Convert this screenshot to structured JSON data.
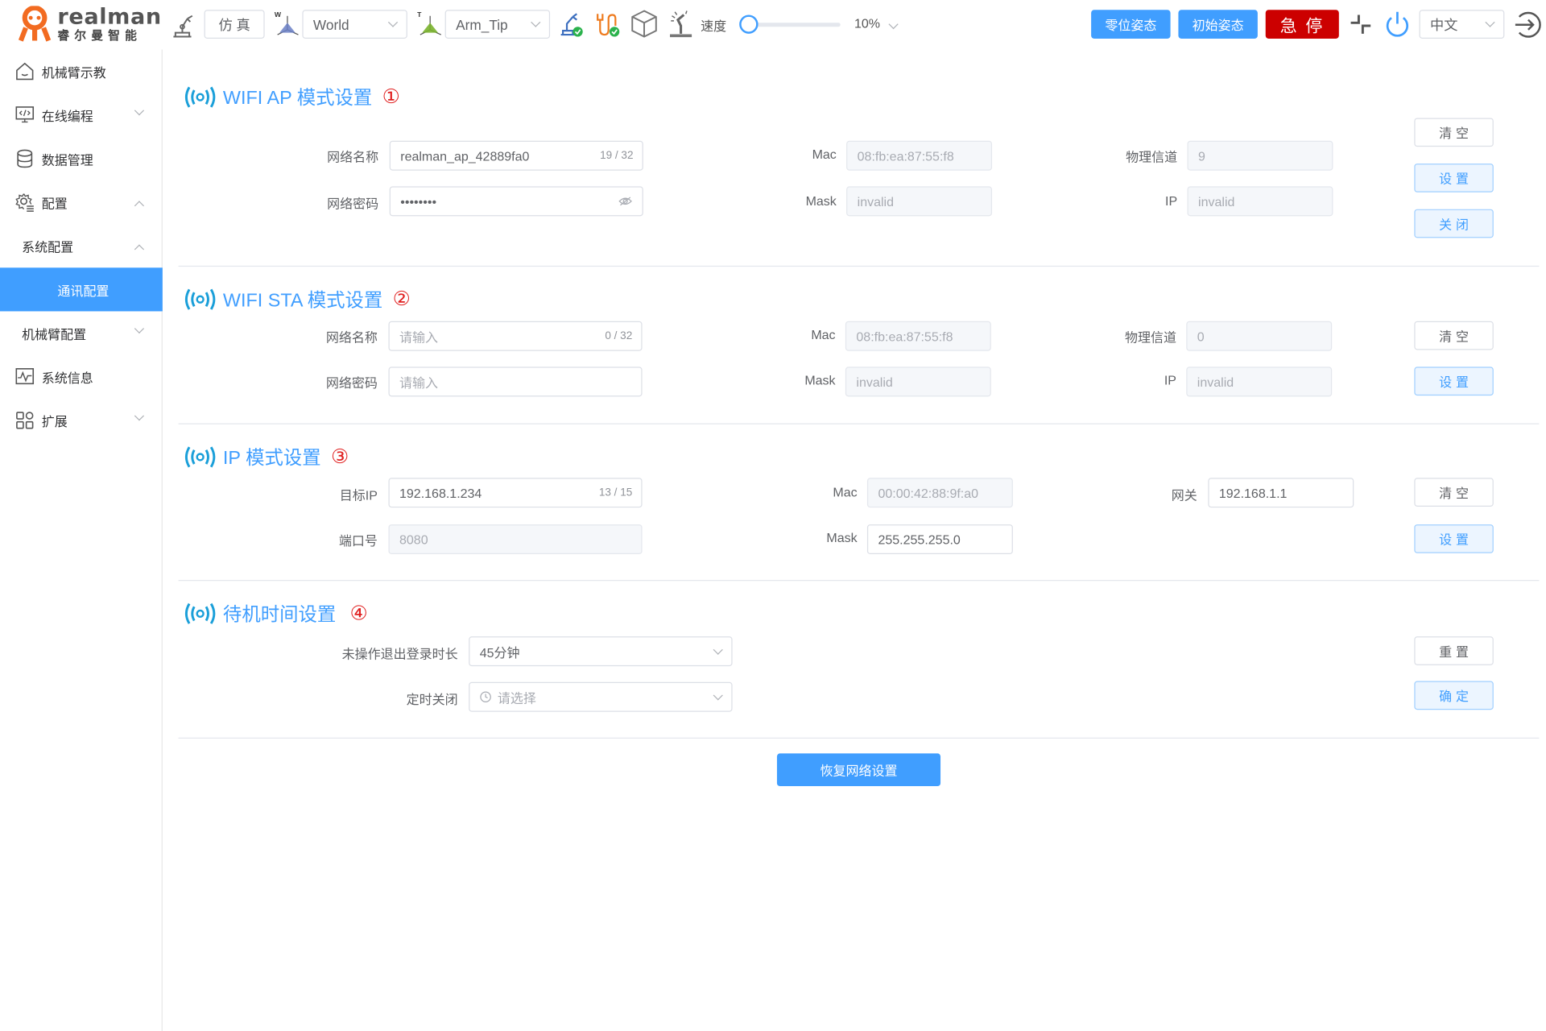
{
  "header": {
    "logo_en": "realman",
    "logo_cn": "睿尔曼智能",
    "sim_button": "仿 真",
    "frame_select": "World",
    "tool_select": "Arm_Tip",
    "speed_label": "速度",
    "speed_value": "10%",
    "speed_fraction": 0.1,
    "zero_pose_button": "零位姿态",
    "init_pose_button": "初始姿态",
    "estop_button": "急 停",
    "language_select": "中文",
    "colors": {
      "primary": "#409eff",
      "estop": "#cc0000"
    }
  },
  "sidebar": {
    "items": [
      {
        "label": "机械臂示教",
        "icon": "home-icon"
      },
      {
        "label": "在线编程",
        "icon": "code-monitor-icon",
        "chevron": "down"
      },
      {
        "label": "数据管理",
        "icon": "database-icon"
      },
      {
        "label": "配置",
        "icon": "settings-gear-icon",
        "chevron": "up"
      },
      {
        "label": "系统配置",
        "chevron": "up"
      },
      {
        "label": "通讯配置",
        "active": true
      },
      {
        "label": "机械臂配置",
        "chevron": "down"
      },
      {
        "label": "系统信息",
        "icon": "waveform-monitor-icon"
      },
      {
        "label": "扩展",
        "icon": "grid-apps-icon",
        "chevron": "down"
      }
    ]
  },
  "ap": {
    "title": "WIFI AP 模式设置",
    "num": "①",
    "ssid_label": "网络名称",
    "ssid_value": "realman_ap_42889fa0",
    "ssid_count": "19 / 32",
    "pwd_label": "网络密码",
    "pwd_value": "••••••••",
    "mac_label": "Mac",
    "mac_value": "08:fb:ea:87:55:f8",
    "mask_label": "Mask",
    "mask_value": "invalid",
    "channel_label": "物理信道",
    "channel_value": "9",
    "ip_label": "IP",
    "ip_value": "invalid",
    "clear_button": "清空",
    "set_button": "设置",
    "close_button": "关闭"
  },
  "sta": {
    "title": "WIFI STA 模式设置",
    "num": "②",
    "ssid_label": "网络名称",
    "ssid_placeholder": "请输入",
    "ssid_count": "0 / 32",
    "pwd_label": "网络密码",
    "pwd_placeholder": "请输入",
    "mac_label": "Mac",
    "mac_value": "08:fb:ea:87:55:f8",
    "mask_label": "Mask",
    "mask_value": "invalid",
    "channel_label": "物理信道",
    "channel_value": "0",
    "ip_label": "IP",
    "ip_value": "invalid",
    "clear_button": "清空",
    "set_button": "设置"
  },
  "ipmode": {
    "title": "IP 模式设置",
    "num": "③",
    "target_ip_label": "目标IP",
    "target_ip_value": "192.168.1.234",
    "target_ip_count": "13 / 15",
    "port_label": "端口号",
    "port_value": "8080",
    "mac_label": "Mac",
    "mac_value": "00:00:42:88:9f:a0",
    "mask_label": "Mask",
    "mask_value": "255.255.255.0",
    "gateway_label": "网关",
    "gateway_value": "192.168.1.1",
    "clear_button": "清空",
    "set_button": "设置"
  },
  "standby": {
    "title": "待机时间设置",
    "num": "④",
    "logout_label": "未操作退出登录时长",
    "logout_value": "45分钟",
    "shutdown_label": "定时关闭",
    "shutdown_placeholder": "请选择",
    "reset_button": "重置",
    "confirm_button": "确定"
  },
  "restore_button": "恢复网络设置"
}
